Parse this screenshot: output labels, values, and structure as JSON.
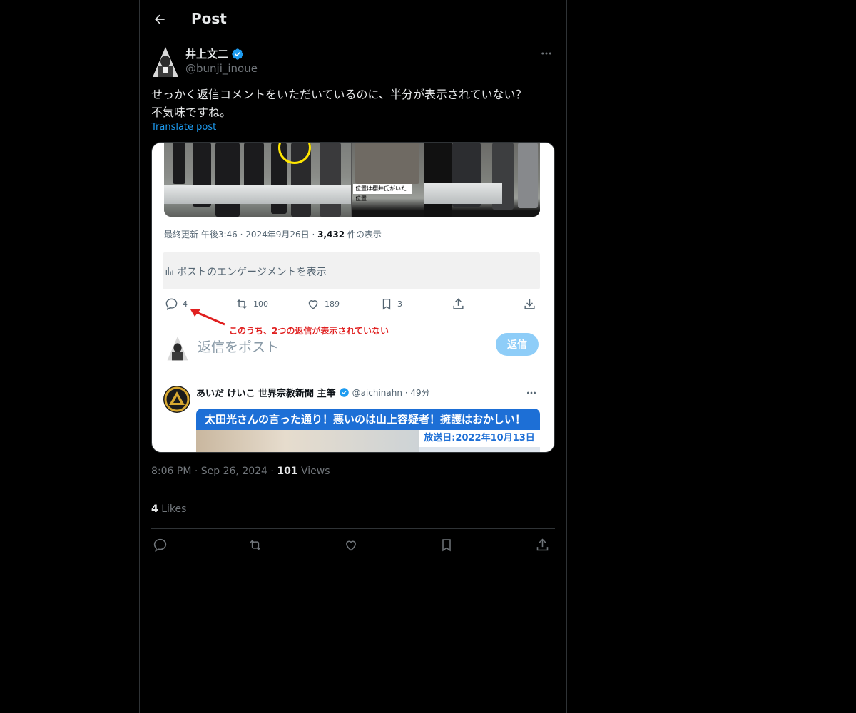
{
  "header": {
    "title": "Post",
    "back_icon": "arrow-left-icon"
  },
  "author": {
    "name": "井上文二",
    "handle": "@bunji_inoue",
    "verified": true,
    "verified_color": "#1d9bf0"
  },
  "post": {
    "text_line1": "せっかく返信コメントをいただいているのに、半分が表示されていない？",
    "text_line2": "不気味ですね。",
    "translate_label": "Translate post"
  },
  "media": {
    "photo_caption": "位置は櫻井氏がいた位置",
    "meta_prefix": "最終更新 午後3:46 · 2024年9月26日 · ",
    "meta_views_count": "3,432",
    "meta_views_suffix": " 件の表示",
    "engagement_label": "ポストのエンゲージメントを表示",
    "actions": {
      "replies": "4",
      "reposts": "100",
      "likes": "189",
      "bookmarks": "3"
    },
    "annotation": "このうち、2つの返信が表示されていない",
    "reply_placeholder": "返信をポスト",
    "reply_button": "返信",
    "reply": {
      "name": "あいだ けいこ 世界宗教新聞 主筆",
      "handle": "@aichinahn · 49分",
      "banner_title": "太田光さんの言った通り！悪いのは山上容疑者！擁護はおかしい！",
      "banner_date": "放送日:2022年10月13日"
    }
  },
  "stats": {
    "time": "8:06 PM",
    "date": "Sep 26, 2024",
    "views_count": "101",
    "views_label": "Views",
    "likes_count": "4",
    "likes_label": "Likes"
  },
  "colors": {
    "background": "#000000",
    "text_primary": "#e7e9ea",
    "text_secondary": "#71767b",
    "accent": "#1d9bf0",
    "annotation_red": "#e02020"
  }
}
